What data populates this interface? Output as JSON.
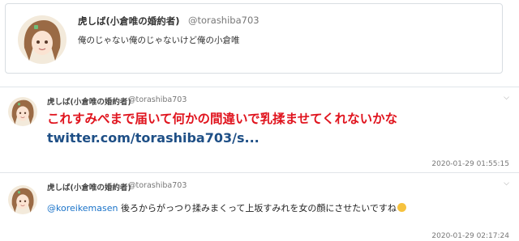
{
  "profile": {
    "name": "虎しば(小倉唯の婚約者)",
    "handle": "@torashiba703",
    "bio": "俺のじゃない俺のじゃないけど俺の小倉唯"
  },
  "tweets": [
    {
      "name": "虎しば(小倉唯の婚約者)",
      "handle": "@torashiba703",
      "text": "これすみぺまで届いて何かの間違いで乳揉ませてくれないかな",
      "link": "twitter.com/torashiba703/s...",
      "timestamp": "2020-01-29 01:55:15",
      "menu_icon": "chevron-down-icon"
    },
    {
      "name": "虎しば(小倉唯の婚約者)",
      "handle": "@torashiba703",
      "mention": "@koreikemasen",
      "text": " 後ろからがっつり揉みまくって上坂すみれを女の顔にさせたいですね",
      "emoji": "smiling-face-emoji",
      "timestamp": "2020-01-29 02:17:24",
      "menu_icon": "chevron-down-icon"
    }
  ],
  "colors": {
    "accent_red": "#e0141e",
    "link_blue": "#1e4f86",
    "mention_blue": "#1a73c9"
  }
}
